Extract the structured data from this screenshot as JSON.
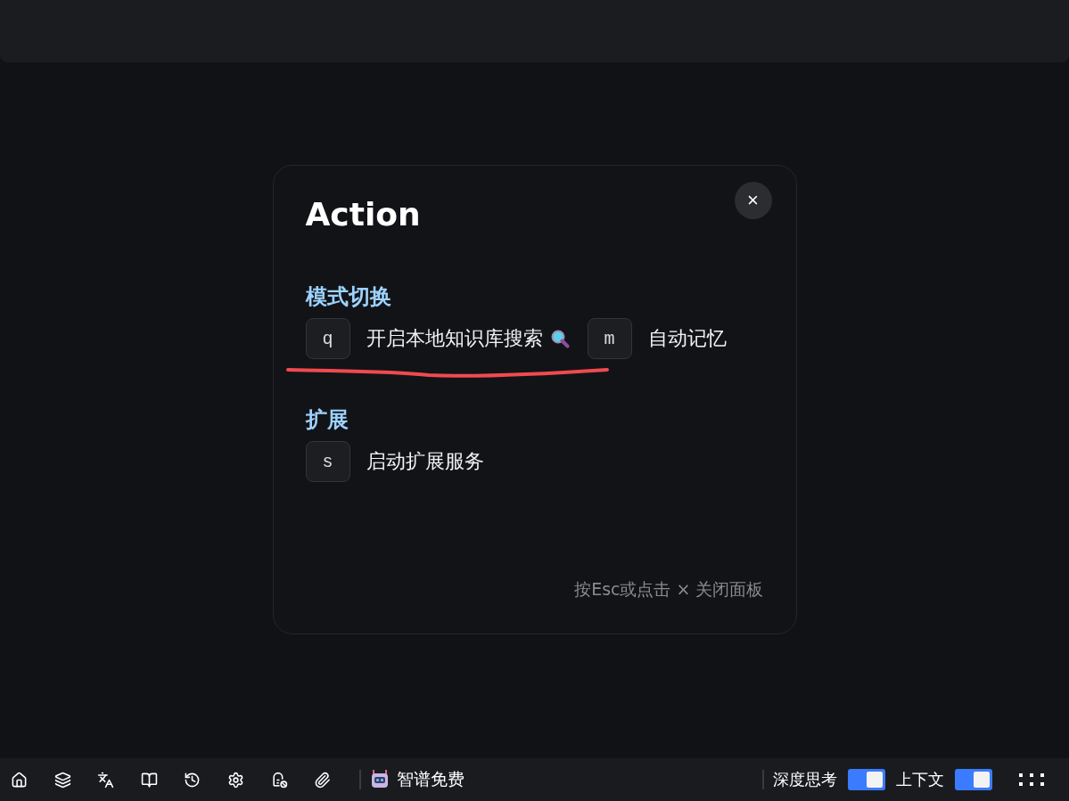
{
  "dialog": {
    "title": "Action",
    "close": "×",
    "sections": [
      {
        "heading": "模式切换",
        "items": [
          {
            "key": "q",
            "label": "开启本地知识库搜索",
            "search_icon": true,
            "underlined": true
          },
          {
            "key": "m",
            "label": "自动记忆",
            "search_icon": false,
            "underlined": false
          }
        ]
      },
      {
        "heading": "扩展",
        "items": [
          {
            "key": "s",
            "label": "启动扩展服务",
            "search_icon": false,
            "underlined": false
          }
        ]
      }
    ],
    "hint": "按Esc或点击 × 关闭面板"
  },
  "toolbar": {
    "tools": [
      {
        "kind": "home"
      },
      {
        "kind": "layers"
      },
      {
        "kind": "translate"
      },
      {
        "kind": "book"
      },
      {
        "kind": "history"
      },
      {
        "kind": "settings"
      },
      {
        "kind": "file-off"
      },
      {
        "kind": "attach"
      }
    ],
    "model": "智谱免费",
    "toggles": [
      {
        "label": "深度思考",
        "on": true
      },
      {
        "label": "上下文",
        "on": true
      }
    ]
  }
}
